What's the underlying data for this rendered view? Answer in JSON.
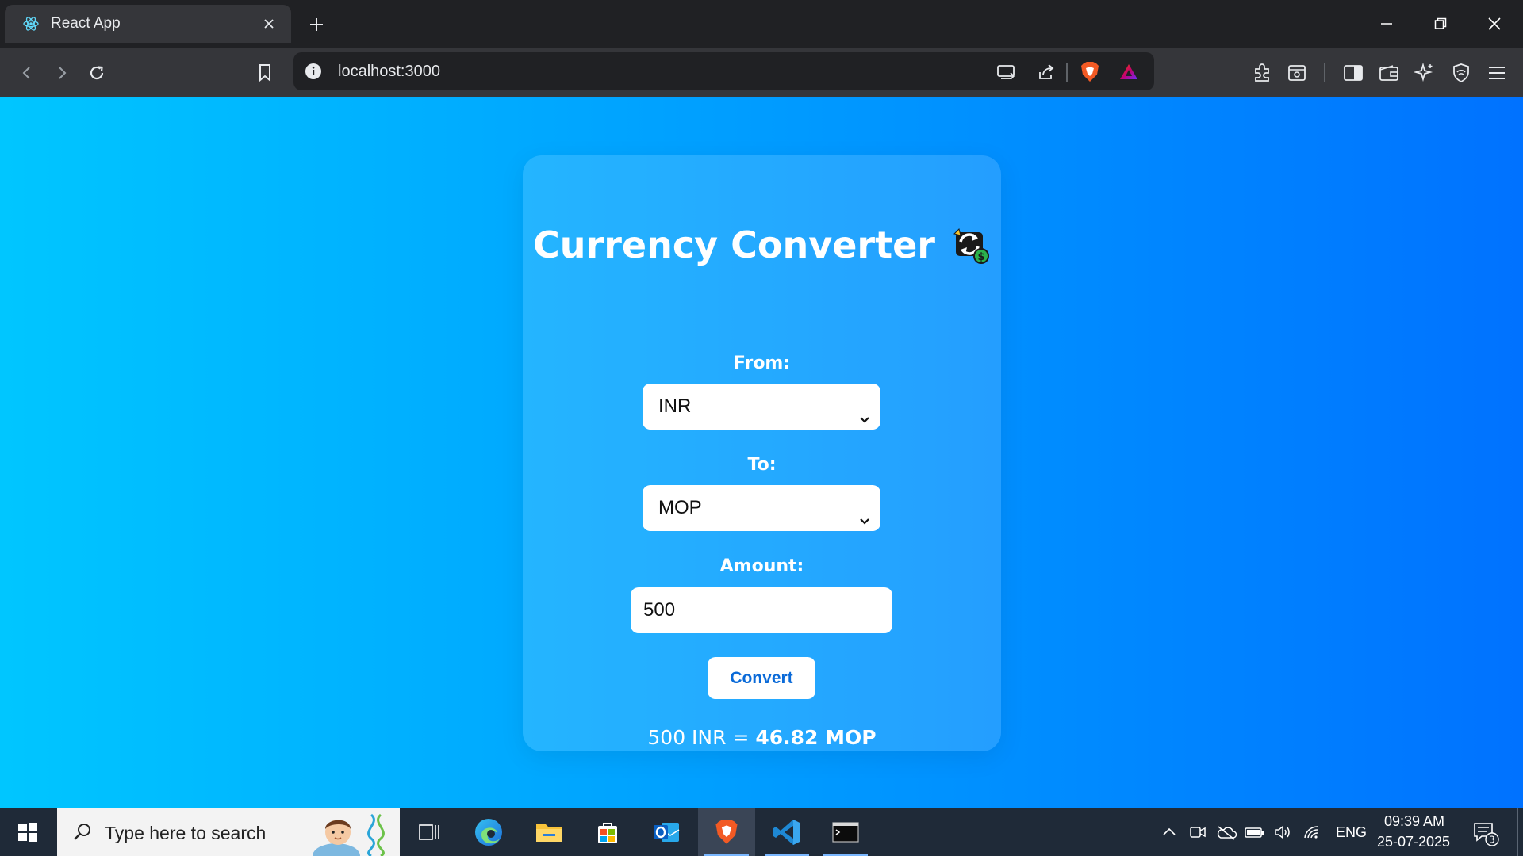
{
  "browser": {
    "tab_title": "React App",
    "url": "localhost:3000",
    "icons": {
      "tab_favicon": "react-icon",
      "tab_close": "close-icon",
      "new_tab": "plus-icon",
      "back": "back-arrow-icon",
      "forward": "forward-arrow-icon",
      "reload": "reload-icon",
      "bookmark": "bookmark-icon",
      "site_info": "info-icon",
      "cast": "cast-icon",
      "share": "share-icon",
      "brave_shields": "brave-lion-icon",
      "brave_rewards": "rewards-triangle-icon",
      "extensions": "puzzle-icon",
      "screenshot": "capture-icon",
      "sidebar": "sidebar-icon",
      "wallet": "wallet-icon",
      "leo": "sparkle-icon",
      "vpn": "vpn-shield-icon",
      "menu": "menu-icon"
    }
  },
  "app": {
    "title": "Currency Converter",
    "title_icon": "currency-exchange-icon",
    "from_label": "From:",
    "from_value": "INR",
    "to_label": "To:",
    "to_value": "MOP",
    "amount_label": "Amount:",
    "amount_value": "500",
    "convert_label": "Convert",
    "result_prefix": "500 INR =",
    "result_value": "46.82 MOP"
  },
  "taskbar": {
    "search_placeholder": "Type here to search",
    "language": "ENG",
    "time": "09:39 AM",
    "date": "25-07-2025",
    "notification_count": "3",
    "apps": [
      "task-view-icon",
      "edge-icon",
      "file-explorer-icon",
      "store-icon",
      "outlook-icon",
      "brave-icon",
      "vscode-icon",
      "terminal-icon"
    ]
  },
  "colors": {
    "gradient_start": "#00c6ff",
    "gradient_end": "#0072ff",
    "button_text": "#0a6ad8"
  }
}
